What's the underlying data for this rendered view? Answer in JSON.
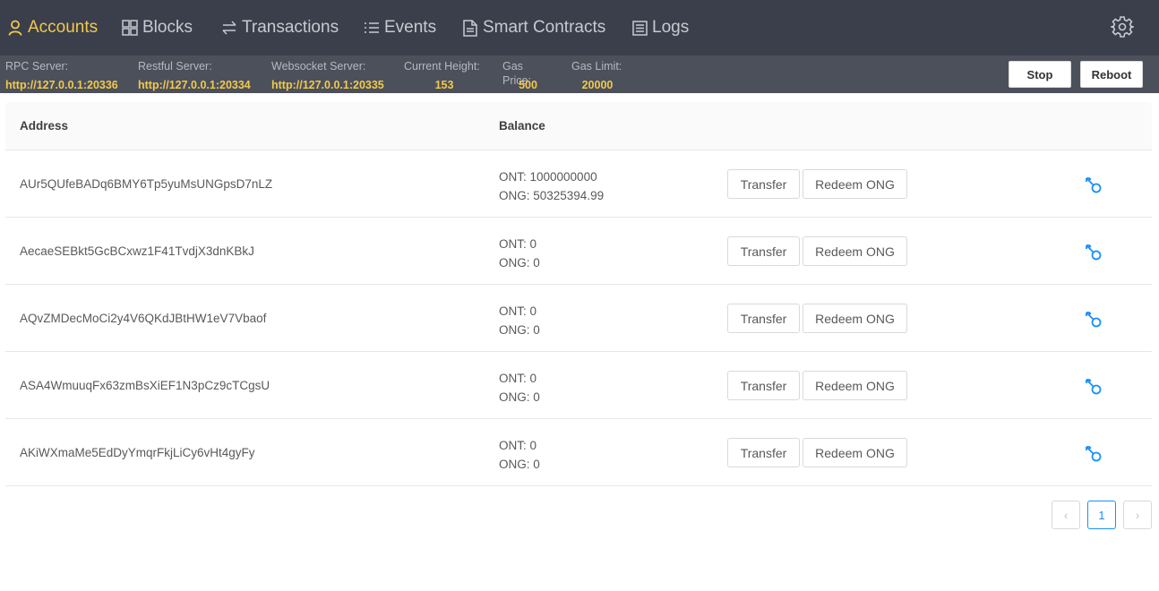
{
  "nav": {
    "items": [
      {
        "label": "Accounts",
        "icon": "user-icon",
        "active": true
      },
      {
        "label": "Blocks",
        "icon": "grid-icon"
      },
      {
        "label": "Transactions",
        "icon": "swap-icon"
      },
      {
        "label": "Events",
        "icon": "list-icon"
      },
      {
        "label": "Smart Contracts",
        "icon": "file-icon"
      },
      {
        "label": "Logs",
        "icon": "log-icon"
      }
    ],
    "settings_icon": "gear-icon"
  },
  "status": {
    "rpc_label": "RPC Server:",
    "rpc_value": "http://127.0.0.1:20336",
    "restful_label": "Restful Server:",
    "restful_value": "http://127.0.0.1:20334",
    "ws_label": "Websocket Server:",
    "ws_value": "http://127.0.0.1:20335",
    "height_label": "Current Height:",
    "height_value": "153",
    "gasprice_label": "Gas Price:",
    "gasprice_value": "500",
    "gaslimit_label": "Gas Limit:",
    "gaslimit_value": "20000",
    "stop_label": "Stop",
    "reboot_label": "Reboot"
  },
  "table": {
    "headers": {
      "address": "Address",
      "balance": "Balance"
    },
    "rows": [
      {
        "address": "AUr5QUfeBADq6BMY6Tp5yuMsUNGpsD7nLZ",
        "ont": "ONT: 1000000000",
        "ong": "ONG: 50325394.99",
        "transfer": "Transfer",
        "redeem": "Redeem ONG"
      },
      {
        "address": "AecaeSEBkt5GcBCxwz1F41TvdjX3dnKBkJ",
        "ont": "ONT: 0",
        "ong": "ONG: 0",
        "transfer": "Transfer",
        "redeem": "Redeem ONG"
      },
      {
        "address": "AQvZMDecMoCi2y4V6QKdJBtHW1eV7Vbaof",
        "ont": "ONT: 0",
        "ong": "ONG: 0",
        "transfer": "Transfer",
        "redeem": "Redeem ONG"
      },
      {
        "address": "ASA4WmuuqFx63zmBsXiEF1N3pCz9cTCgsU",
        "ont": "ONT: 0",
        "ong": "ONG: 0",
        "transfer": "Transfer",
        "redeem": "Redeem ONG"
      },
      {
        "address": "AKiWXmaMe5EdDyYmqrFkjLiCy6vHt4gyFy",
        "ont": "ONT: 0",
        "ong": "ONG: 0",
        "transfer": "Transfer",
        "redeem": "Redeem ONG"
      }
    ]
  },
  "pagination": {
    "prev": "‹",
    "current": "1",
    "next": "›"
  },
  "colors": {
    "nav_bg": "#3a3f4b",
    "status_bg": "#4b505b",
    "accent": "#f2c94c",
    "link": "#1890ff"
  }
}
